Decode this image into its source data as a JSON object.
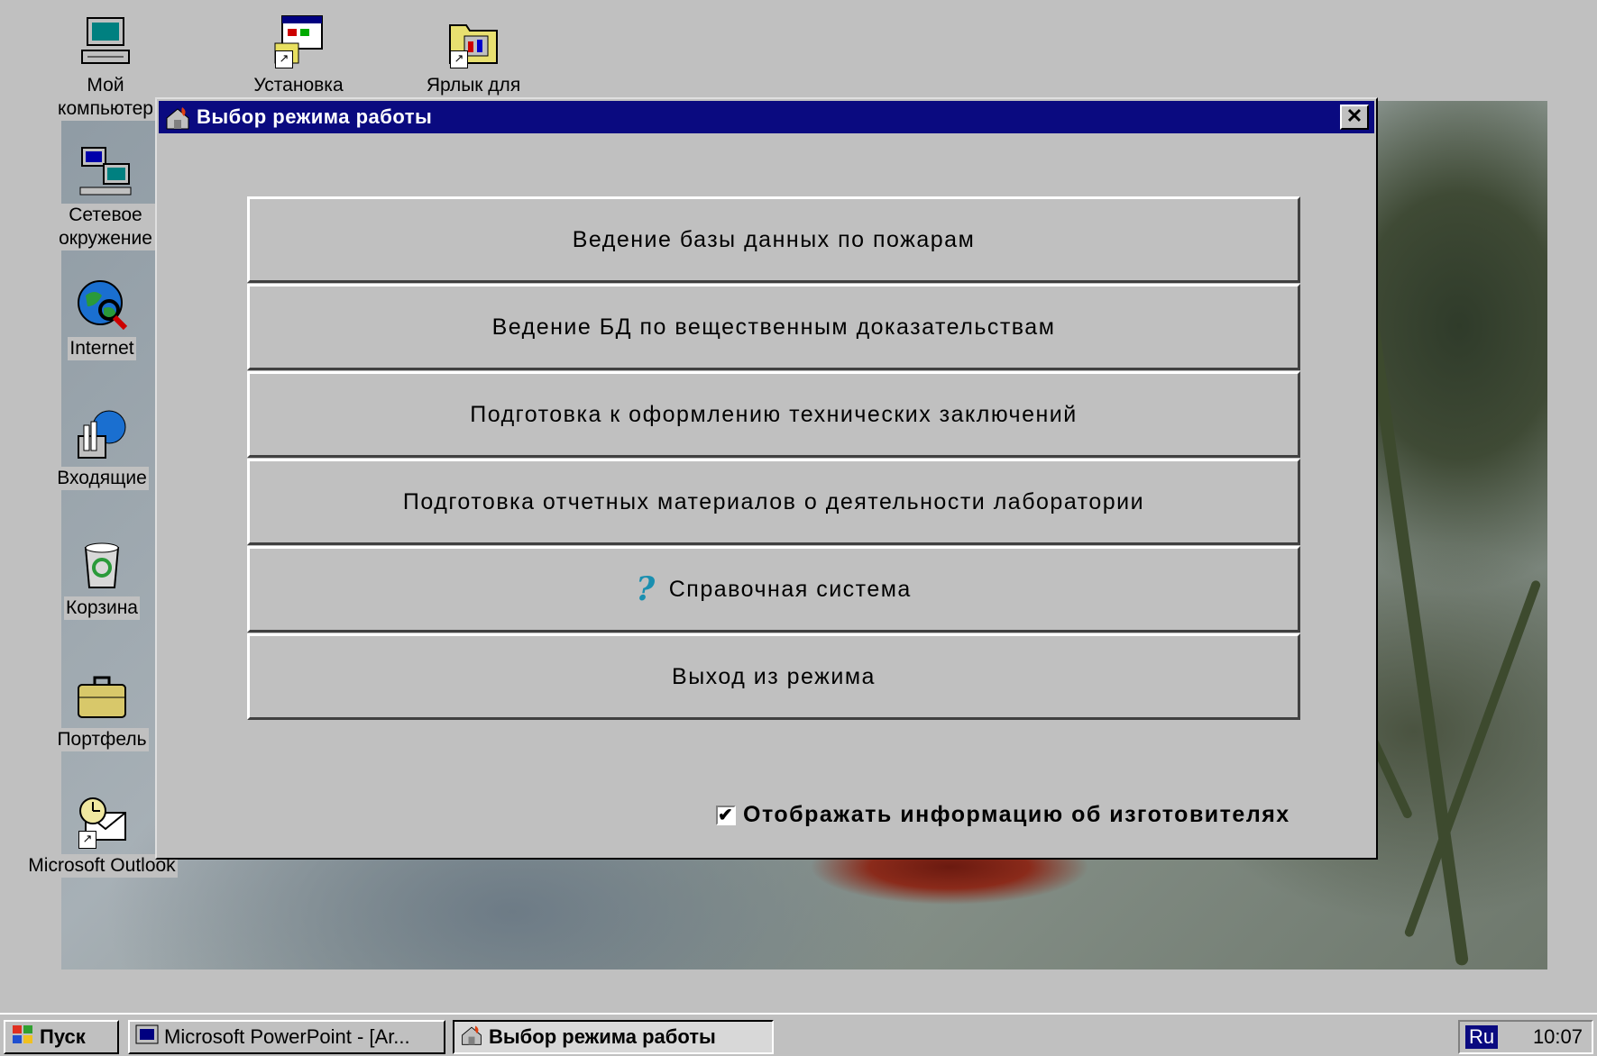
{
  "desktop": {
    "icons": [
      {
        "label": "Мой компьютер"
      },
      {
        "label": "Установка"
      },
      {
        "label": "Ярлык для"
      },
      {
        "label": "Сетевое окружение"
      },
      {
        "label": "Internet"
      },
      {
        "label": "Входящие"
      },
      {
        "label": "Корзина"
      },
      {
        "label": "Портфель"
      },
      {
        "label": "Microsoft Outlook"
      }
    ]
  },
  "dialog": {
    "title": "Выбор режима работы",
    "close_label": "✕",
    "buttons": [
      {
        "label": "Ведение базы данных по пожарам"
      },
      {
        "label": "Ведение БД по вещественным доказательствам"
      },
      {
        "label": "Подготовка к оформлению технических заключений"
      },
      {
        "label": "Подготовка отчетных материалов о деятельности лаборатории"
      },
      {
        "label": "Справочная система",
        "icon": "help-question-icon"
      },
      {
        "label": "Выход из режима"
      }
    ],
    "help_glyph": "?",
    "checkbox": {
      "label": "Отображать информацию об изготовителях",
      "checked": true,
      "mark": "✔"
    }
  },
  "taskbar": {
    "start_label": "Пуск",
    "tasks": [
      {
        "label": "Microsoft PowerPoint - [Ar..."
      },
      {
        "label": "Выбор режима работы"
      }
    ],
    "lang": "Ru",
    "clock": "10:07"
  }
}
